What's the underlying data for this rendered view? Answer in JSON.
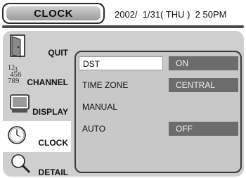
{
  "header": {
    "title": "CLOCK",
    "datetime": "2002/  1/31( THU )  2 50PM"
  },
  "sidebar": {
    "items": [
      {
        "label": "QUIT",
        "icon": "door-icon",
        "selected": false
      },
      {
        "label": "CHANNEL",
        "icon": "channel-numbers-icon",
        "icon_text": "123456789",
        "selected": false
      },
      {
        "label": "DISPLAY",
        "icon": "monitor-icon",
        "selected": false
      },
      {
        "label": "CLOCK",
        "icon": "clock-icon",
        "selected": true
      },
      {
        "label": "DETAIL",
        "icon": "magnifier-icon",
        "selected": false
      }
    ]
  },
  "settings": [
    {
      "label": "DST",
      "value": "ON"
    },
    {
      "label": "TIME ZONE",
      "value": "CENTRAL"
    },
    {
      "label": "MANUAL",
      "value": ""
    },
    {
      "label": "AUTO",
      "value": "OFF"
    }
  ],
  "colors": {
    "value_bg": "#6c6c6c",
    "sidebar_bg": "#cfcfcf",
    "panel_bg": "#c8c8c8"
  }
}
